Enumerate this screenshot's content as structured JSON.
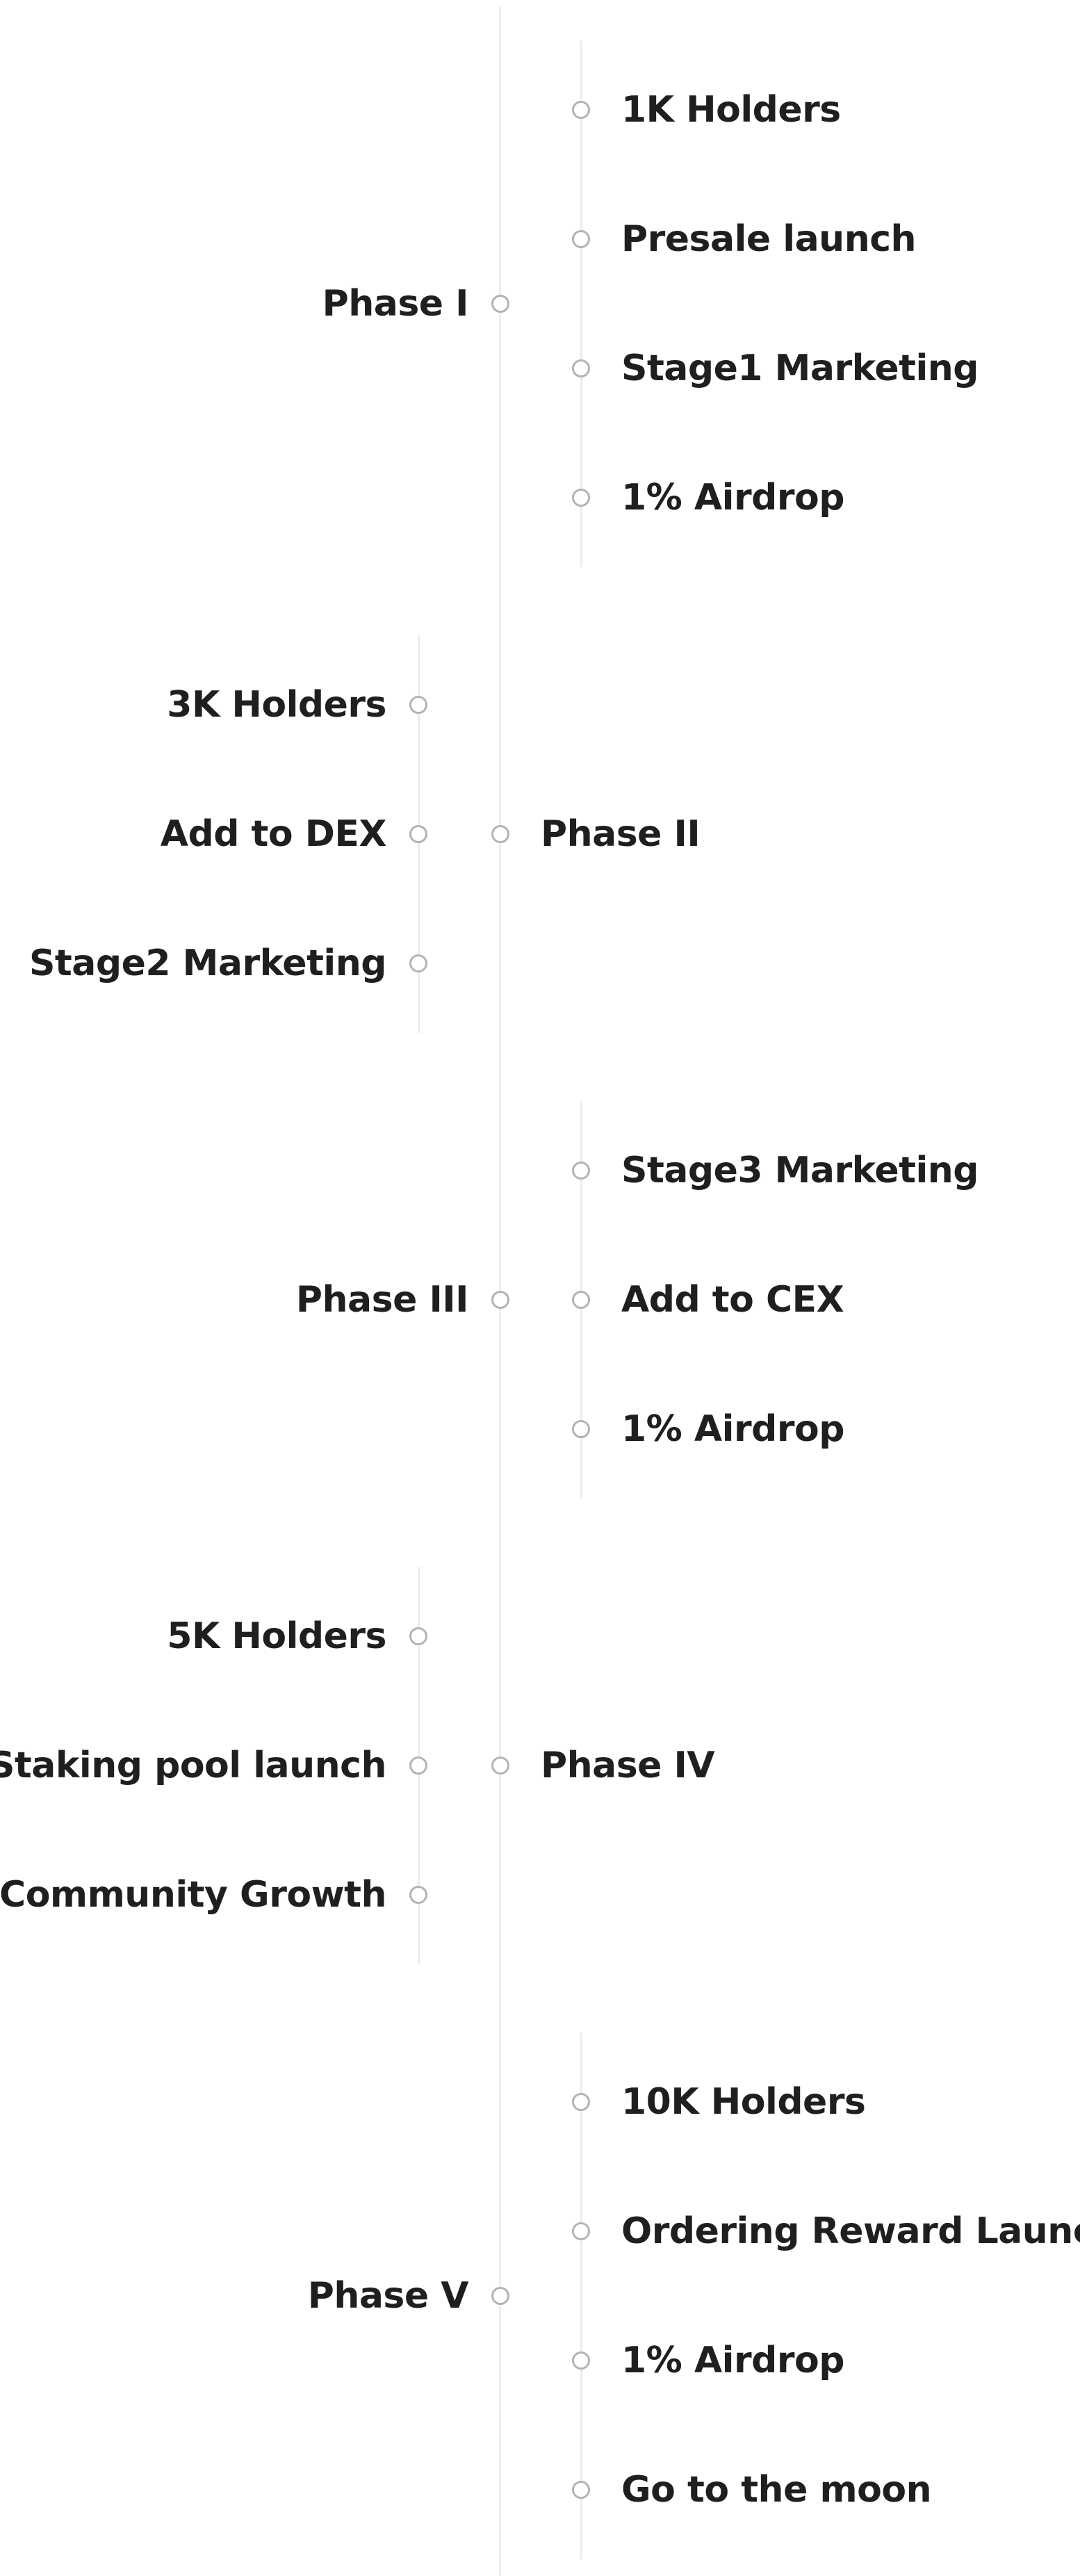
{
  "phases": [
    {
      "name": "Phase I",
      "side": "right",
      "milestones": [
        "1K Holders",
        "Presale launch",
        "Stage1 Marketing",
        "1% Airdrop"
      ]
    },
    {
      "name": "Phase II",
      "side": "left",
      "milestones": [
        "3K Holders",
        "Add to DEX",
        "Stage2 Marketing"
      ]
    },
    {
      "name": "Phase III",
      "side": "right",
      "milestones": [
        "Stage3 Marketing",
        "Add to CEX",
        "1% Airdrop"
      ]
    },
    {
      "name": "Phase IV",
      "side": "left",
      "milestones": [
        "5K Holders",
        "Staking pool launch",
        "Community Growth"
      ]
    },
    {
      "name": "Phase V",
      "side": "right",
      "milestones": [
        "10K Holders",
        "Ordering Reward Launch",
        "1% Airdrop",
        "Go to the moon"
      ]
    }
  ],
  "colors": {
    "text": "#1f1f1f",
    "dot_border": "#b3b3b3",
    "line": "#eeeeee"
  }
}
